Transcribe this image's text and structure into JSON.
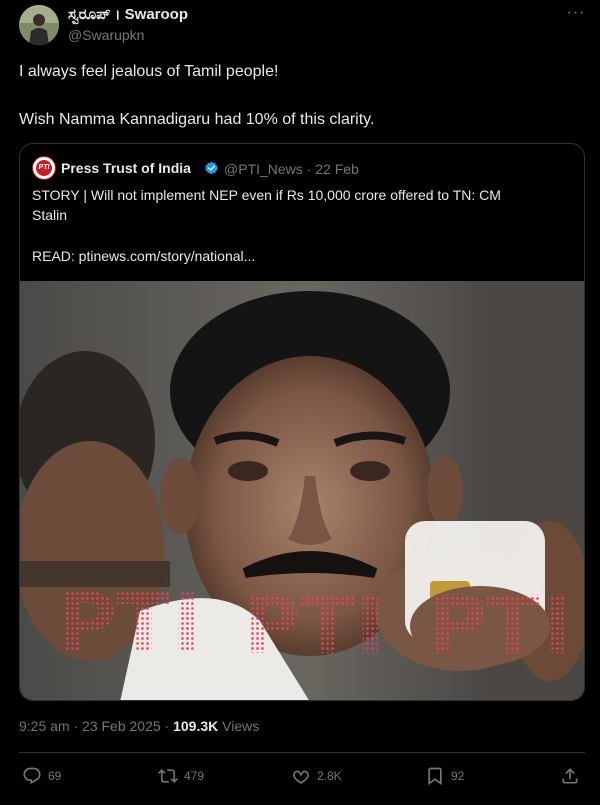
{
  "author": {
    "name": "ಸ್ವರೂಪ್ । Swaroop",
    "handle": "@Swarupkn"
  },
  "more_icon_glyph": "···",
  "tweet": {
    "line1": "I always feel jealous of Tamil people!",
    "line2": "Wish Namma Kannadigaru had 10% of this clarity."
  },
  "quote": {
    "name": "Press Trust of India",
    "handle_date": "@PTI_News · 22 Feb",
    "text_line1": "STORY | Will not implement NEP even if Rs 10,000 crore offered to TN: CM",
    "text_line2": "Stalin",
    "text_line3": "READ: ptinews.com/story/national...",
    "avatar_text": "PTI",
    "watermarks": [
      "PTI",
      "PTI",
      "PTI"
    ]
  },
  "meta": {
    "time_date": "9:25 am · 23 Feb 2025 · ",
    "views_count": "109.3K",
    "views_label": " Views"
  },
  "actions": {
    "replies": "69",
    "retweets": "479",
    "likes": "2.8K",
    "bookmarks": "92"
  },
  "icons": {
    "reply": "reply-icon",
    "retweet": "retweet-icon",
    "like": "heart-icon",
    "bookmark": "bookmark-icon",
    "share": "share-icon",
    "verified": "verified-badge-icon"
  },
  "colors": {
    "background": "#000000",
    "text": "#e7e9ea",
    "secondary": "#71767b",
    "border": "#2f3336",
    "verified": "#1d9bf0",
    "watermark": "#e8425a"
  }
}
